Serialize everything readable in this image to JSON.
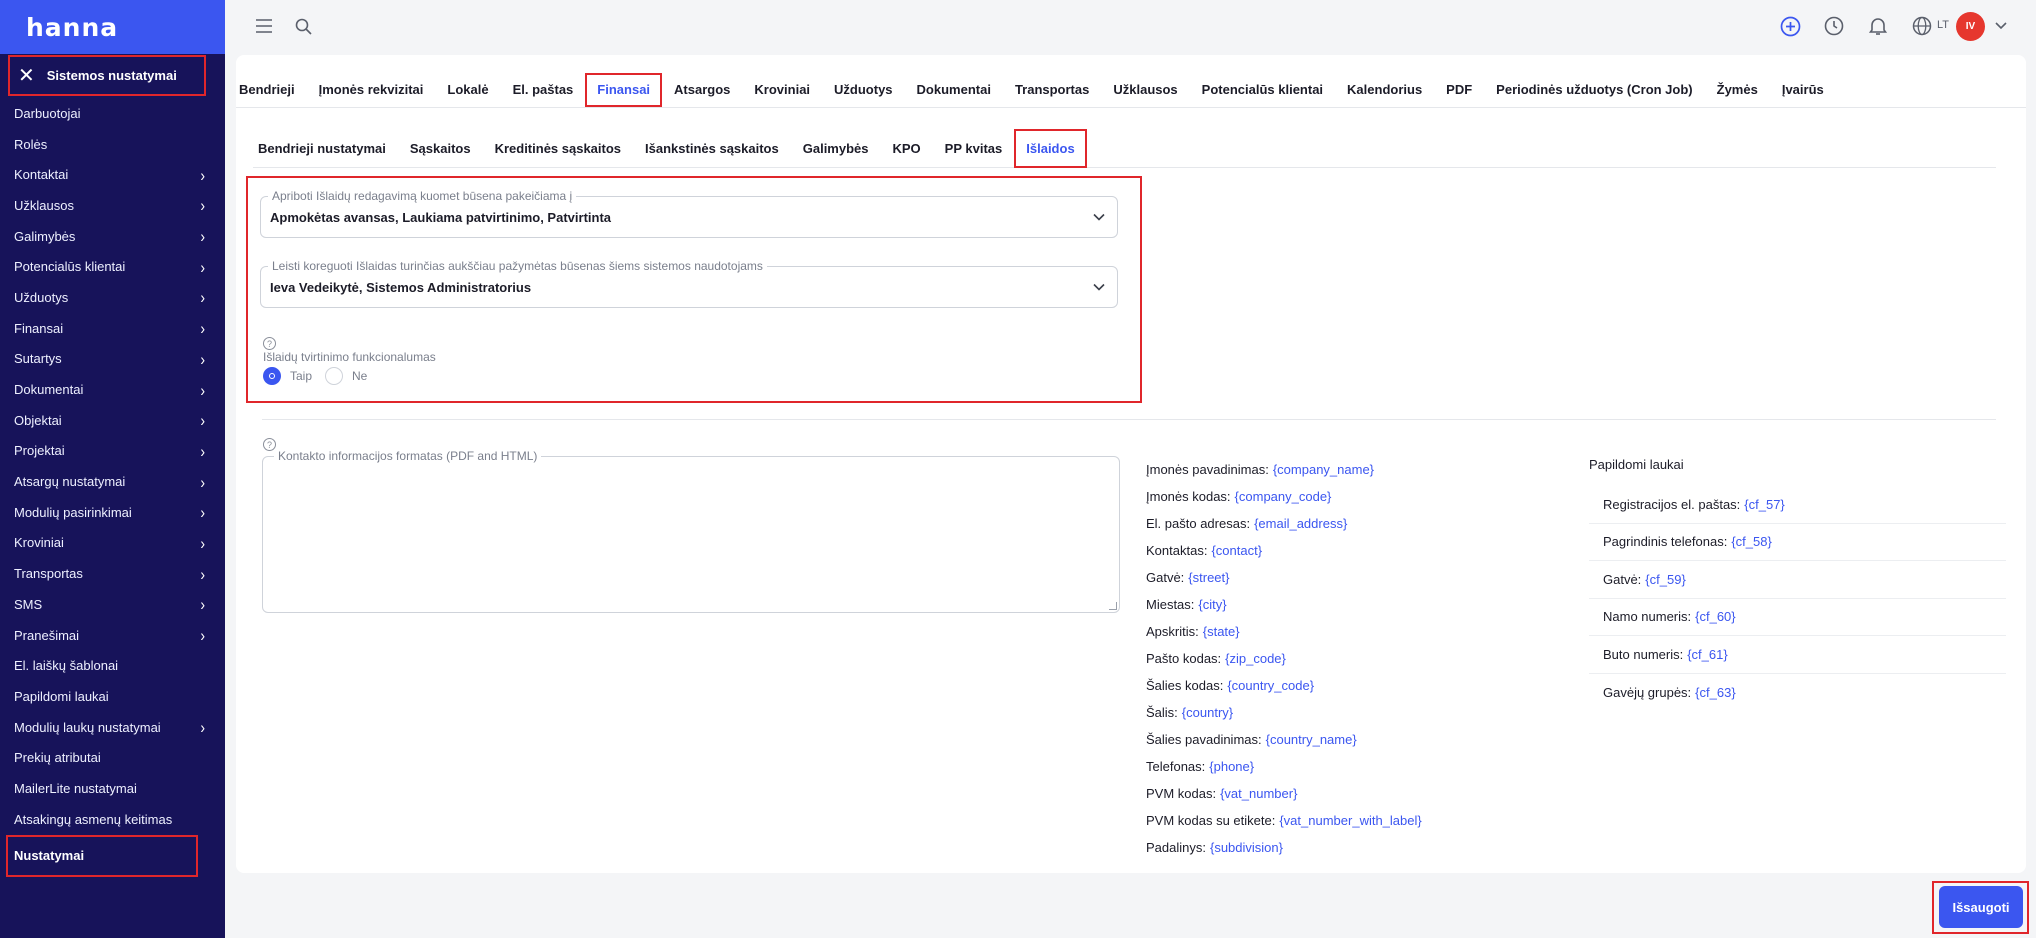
{
  "app": {
    "logo": "hanna"
  },
  "sidebar": {
    "header_label": "Sistemos nustatymai",
    "items": [
      {
        "label": "Darbuotojai",
        "has_submenu": false
      },
      {
        "label": "Rolės",
        "has_submenu": false
      },
      {
        "label": "Kontaktai",
        "has_submenu": true
      },
      {
        "label": "Užklausos",
        "has_submenu": true
      },
      {
        "label": "Galimybės",
        "has_submenu": true
      },
      {
        "label": "Potencialūs klientai",
        "has_submenu": true
      },
      {
        "label": "Užduotys",
        "has_submenu": true
      },
      {
        "label": "Finansai",
        "has_submenu": true
      },
      {
        "label": "Sutartys",
        "has_submenu": true
      },
      {
        "label": "Dokumentai",
        "has_submenu": true
      },
      {
        "label": "Objektai",
        "has_submenu": true
      },
      {
        "label": "Projektai",
        "has_submenu": true
      },
      {
        "label": "Atsargų nustatymai",
        "has_submenu": true
      },
      {
        "label": "Modulių pasirinkimai",
        "has_submenu": true
      },
      {
        "label": "Kroviniai",
        "has_submenu": true
      },
      {
        "label": "Transportas",
        "has_submenu": true
      },
      {
        "label": "SMS",
        "has_submenu": true
      },
      {
        "label": "Pranešimai",
        "has_submenu": true
      },
      {
        "label": "El. laiškų šablonai",
        "has_submenu": false
      },
      {
        "label": "Papildomi laukai",
        "has_submenu": false
      },
      {
        "label": "Modulių laukų nustatymai",
        "has_submenu": true
      },
      {
        "label": "Prekių atributai",
        "has_submenu": false
      },
      {
        "label": "MailerLite nustatymai",
        "has_submenu": false
      },
      {
        "label": "Atsakingų asmenų keitimas",
        "has_submenu": false
      },
      {
        "label": "Nustatymai",
        "has_submenu": false,
        "active": true
      }
    ]
  },
  "topbar": {
    "icons": [
      "menu-icon",
      "search-icon",
      "add-circle-icon",
      "clock-icon",
      "bell-icon",
      "globe-icon",
      "chevron-down-icon"
    ],
    "language": "LT",
    "avatar_initials": "IV"
  },
  "main_tabs": [
    "Bendrieji",
    "Įmonės rekvizitai",
    "Lokalė",
    "El. paštas",
    "Finansai",
    "Atsargos",
    "Kroviniai",
    "Užduotys",
    "Dokumentai",
    "Transportas",
    "Užklausos",
    "Potencialūs klientai",
    "Kalendorius",
    "PDF",
    "Periodinės užduotys (Cron Job)",
    "Žymės",
    "Įvairūs"
  ],
  "main_tab_active": "Finansai",
  "sub_tabs": [
    "Bendrieji nustatymai",
    "Sąskaitos",
    "Kreditinės sąskaitos",
    "Išankstinės sąskaitos",
    "Galimybės",
    "KPO",
    "PP kvitas",
    "Išlaidos"
  ],
  "sub_tab_active": "Išlaidos",
  "expenses_settings": {
    "restrict_edit": {
      "label": "Apriboti Išlaidų redagavimą kuomet būsena pakeičiama į",
      "value": "Apmokėtas avansas, Laukiama patvirtinimo, Patvirtinta"
    },
    "allow_correct": {
      "label": "Leisti koreguoti Išlaidas turinčias aukščiau pažymėtas būsenas šiems sistemos naudotojams",
      "value": "Ieva Vedeikytė, Sistemos Administratorius"
    },
    "approval": {
      "label": "Išlaidų tvirtinimo funkcionalumas",
      "options": [
        "Taip",
        "Ne"
      ],
      "selected": "Taip"
    }
  },
  "contact_format": {
    "label": "Kontakto informacijos formatas (PDF and HTML)",
    "value": ""
  },
  "placeholders": [
    {
      "label": "Įmonės pavadinimas:",
      "tag": "{company_name}"
    },
    {
      "label": "Įmonės kodas:",
      "tag": "{company_code}"
    },
    {
      "label": "El. pašto adresas:",
      "tag": "{email_address}"
    },
    {
      "label": "Kontaktas:",
      "tag": "{contact}"
    },
    {
      "label": "Gatvė:",
      "tag": "{street}"
    },
    {
      "label": "Miestas:",
      "tag": "{city}"
    },
    {
      "label": "Apskritis:",
      "tag": "{state}"
    },
    {
      "label": "Pašto kodas:",
      "tag": "{zip_code}"
    },
    {
      "label": "Šalies kodas:",
      "tag": "{country_code}"
    },
    {
      "label": "Šalis:",
      "tag": "{country}"
    },
    {
      "label": "Šalies pavadinimas:",
      "tag": "{country_name}"
    },
    {
      "label": "Telefonas:",
      "tag": "{phone}"
    },
    {
      "label": "PVM kodas:",
      "tag": "{vat_number}"
    },
    {
      "label": "PVM kodas su etikete:",
      "tag": "{vat_number_with_label}"
    },
    {
      "label": "Padalinys:",
      "tag": "{subdivision}"
    }
  ],
  "extra_fields": {
    "title": "Papildomi laukai",
    "items": [
      {
        "label": "Registracijos el. paštas:",
        "tag": "{cf_57}"
      },
      {
        "label": "Pagrindinis telefonas:",
        "tag": "{cf_58}"
      },
      {
        "label": "Gatvė:",
        "tag": "{cf_59}"
      },
      {
        "label": "Namo numeris:",
        "tag": "{cf_60}"
      },
      {
        "label": "Buto numeris:",
        "tag": "{cf_61}"
      },
      {
        "label": "Gavėjų grupės:",
        "tag": "{cf_63}"
      }
    ]
  },
  "actions": {
    "save_label": "Išsaugoti"
  },
  "colors": {
    "accent": "#3b56f0",
    "sidebar_bg": "#17135a",
    "highlight": "#e0262b",
    "avatar": "#e6372e"
  }
}
